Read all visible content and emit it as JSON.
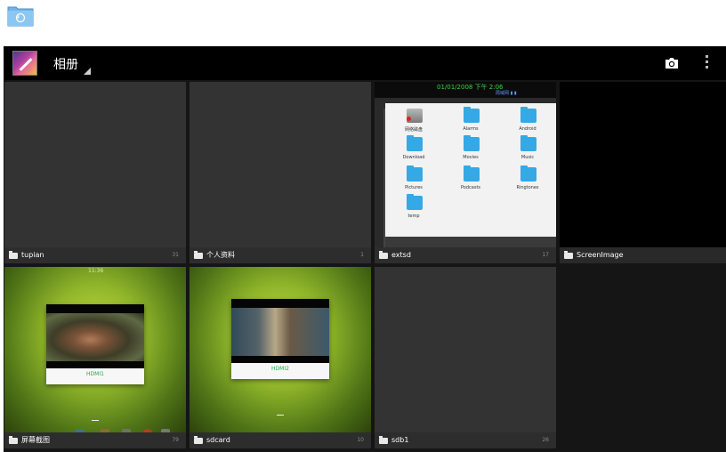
{
  "window_icon": "history-folder-icon",
  "action_bar": {
    "title": "相册",
    "app_icon": "gallery-icon",
    "camera_icon": "camera-icon",
    "overflow_icon": "overflow-menu-icon"
  },
  "albums": [
    {
      "name": "tupian",
      "count": "31",
      "thumb": "blank"
    },
    {
      "name": "个人资料",
      "count": "1",
      "thumb": "blank"
    },
    {
      "name": "extsd",
      "count": "17",
      "thumb": "screenshot"
    },
    {
      "name": "ScreenImage",
      "count": "",
      "thumb": "black"
    },
    {
      "name": "屏幕截图",
      "count": "79",
      "thumb": "hdmi1"
    },
    {
      "name": "sdcard",
      "count": "10",
      "thumb": "hdmi2"
    },
    {
      "name": "sdb1",
      "count": "26",
      "thumb": "blank"
    }
  ],
  "extsd_thumbnail": {
    "status_time": "01/01/2008 下午 2:06",
    "status_net": "局域网 ▮ ▮",
    "folders": [
      "网络磁盘",
      "Alarms",
      "Android",
      "Download",
      "Movies",
      "Music",
      "Pictures",
      "Podcasts",
      "Ringtones",
      "temp"
    ]
  },
  "hdmi_thumbnails": {
    "time": "11:36",
    "captions": [
      "HDMI1",
      "HDMI2"
    ]
  },
  "colors": {
    "action_bar": "#000000",
    "grid_background": "#151515",
    "tile_placeholder": "#333333",
    "folder_blue": "#35a8e6",
    "hdmi_caption_green": "#2fa24a"
  }
}
